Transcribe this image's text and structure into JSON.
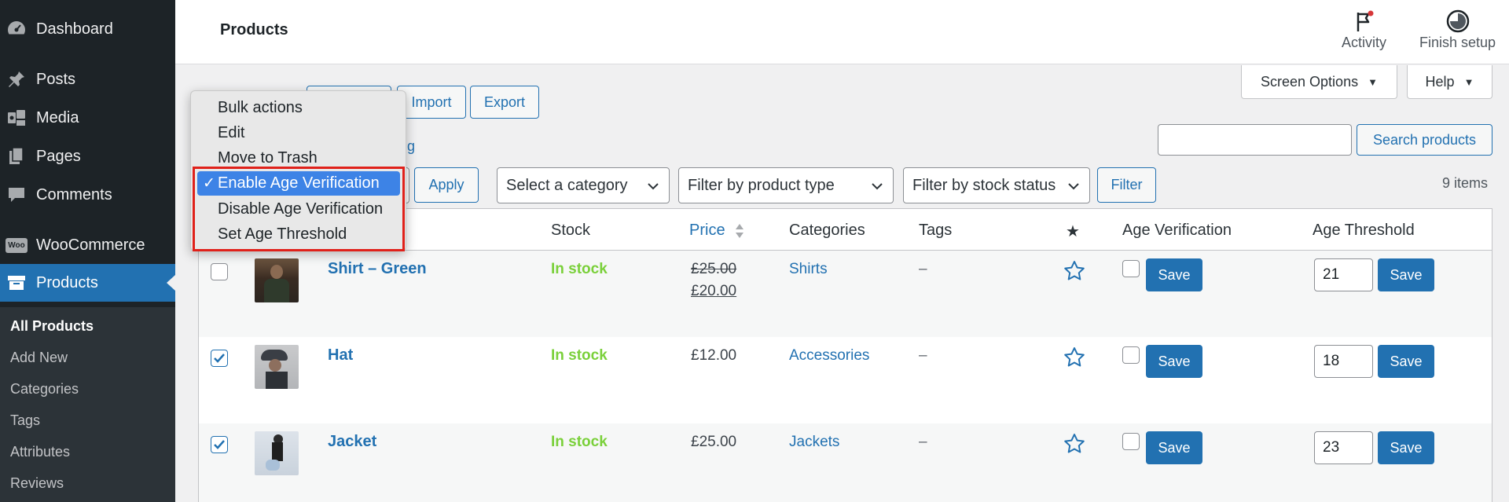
{
  "sidebar": {
    "items": [
      {
        "label": "Dashboard",
        "icon": "dashboard-icon"
      },
      {
        "label": "Posts",
        "icon": "pin-icon"
      },
      {
        "label": "Media",
        "icon": "media-icon"
      },
      {
        "label": "Pages",
        "icon": "pages-icon"
      },
      {
        "label": "Comments",
        "icon": "comment-icon"
      },
      {
        "label": "WooCommerce",
        "icon": "woo-icon",
        "icon_text": "Woo"
      },
      {
        "label": "Products",
        "icon": "archive-icon"
      }
    ],
    "submenu": [
      "All Products",
      "Add New",
      "Categories",
      "Tags",
      "Attributes",
      "Reviews"
    ]
  },
  "header": {
    "title": "Products",
    "activity_label": "Activity",
    "finish_setup_label": "Finish setup"
  },
  "toolbar": {
    "import_label": "Import",
    "export_label": "Export",
    "screen_options_label": "Screen Options",
    "help_label": "Help",
    "search_placeholder": "",
    "search_button": "Search products",
    "partial_link_text": "g",
    "apply_label": "Apply",
    "category_select": "Select a category",
    "product_type_select": "Filter by product type",
    "stock_status_select": "Filter by stock status",
    "filter_label": "Filter",
    "items_count": "9 items"
  },
  "bulk_actions": {
    "options": [
      "Bulk actions",
      "Edit",
      "Move to Trash",
      "Enable Age Verification",
      "Disable Age Verification",
      "Set Age Threshold"
    ],
    "selected": "Enable Age Verification",
    "check": "✓"
  },
  "table": {
    "headers": {
      "stock": "Stock",
      "price": "Price",
      "categories": "Categories",
      "tags": "Tags",
      "featured": "★",
      "age_verification": "Age Verification",
      "age_threshold": "Age Threshold"
    },
    "rows": [
      {
        "name": "Shirt – Green",
        "stock": "In stock",
        "price_old": "£25.00",
        "price": "£20.00",
        "category": "Shirts",
        "tags": "–",
        "checked": false,
        "age_verified": false,
        "threshold": "21",
        "save_label": "Save"
      },
      {
        "name": "Hat",
        "stock": "In stock",
        "price": "£12.00",
        "category": "Accessories",
        "tags": "–",
        "checked": true,
        "age_verified": false,
        "threshold": "18",
        "save_label": "Save"
      },
      {
        "name": "Jacket",
        "stock": "In stock",
        "price": "£25.00",
        "category": "Jackets",
        "tags": "–",
        "checked": true,
        "age_verified": false,
        "threshold": "23",
        "save_label": "Save"
      }
    ]
  },
  "colors": {
    "accent": "#2271b1",
    "sidebar_bg": "#1d2327",
    "in_stock": "#7ad03a",
    "highlight_border": "#e0211a",
    "dropdown_selected": "#3d83e6"
  }
}
